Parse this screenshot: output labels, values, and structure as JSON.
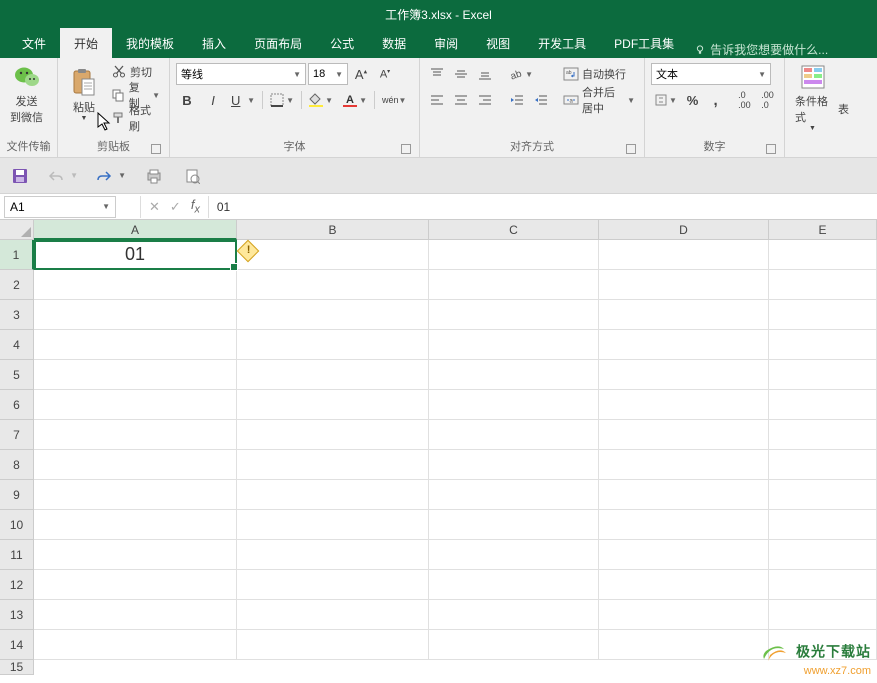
{
  "title": "工作簿3.xlsx - Excel",
  "tabs": [
    "文件",
    "开始",
    "我的模板",
    "插入",
    "页面布局",
    "公式",
    "数据",
    "审阅",
    "视图",
    "开发工具",
    "PDF工具集"
  ],
  "active_tab_index": 1,
  "tellme": "告诉我您想要做什么...",
  "ribbon": {
    "wechat": {
      "label1": "发送",
      "label2": "到微信",
      "group": "文件传输"
    },
    "clipboard": {
      "paste": "粘贴",
      "cut": "剪切",
      "copy": "复制",
      "format_painter": "格式刷",
      "group": "剪贴板"
    },
    "font": {
      "name": "等线",
      "size": "18",
      "group": "字体",
      "wen": "wén"
    },
    "align": {
      "wrap": "自动换行",
      "merge": "合并后居中",
      "group": "对齐方式"
    },
    "number": {
      "format": "文本",
      "group": "数字"
    },
    "styles": {
      "conditional": "条件格式",
      "more": "表"
    }
  },
  "namebox": "A1",
  "formula": "01",
  "columns": [
    "A",
    "B",
    "C",
    "D",
    "E"
  ],
  "rows": [
    "1",
    "2",
    "3",
    "4",
    "5",
    "6",
    "7",
    "8",
    "9",
    "10",
    "11",
    "12",
    "13",
    "14",
    "15"
  ],
  "active_cell_value": "01",
  "watermark": {
    "line1": "极光下载站",
    "line2": "www.xz7.com"
  }
}
